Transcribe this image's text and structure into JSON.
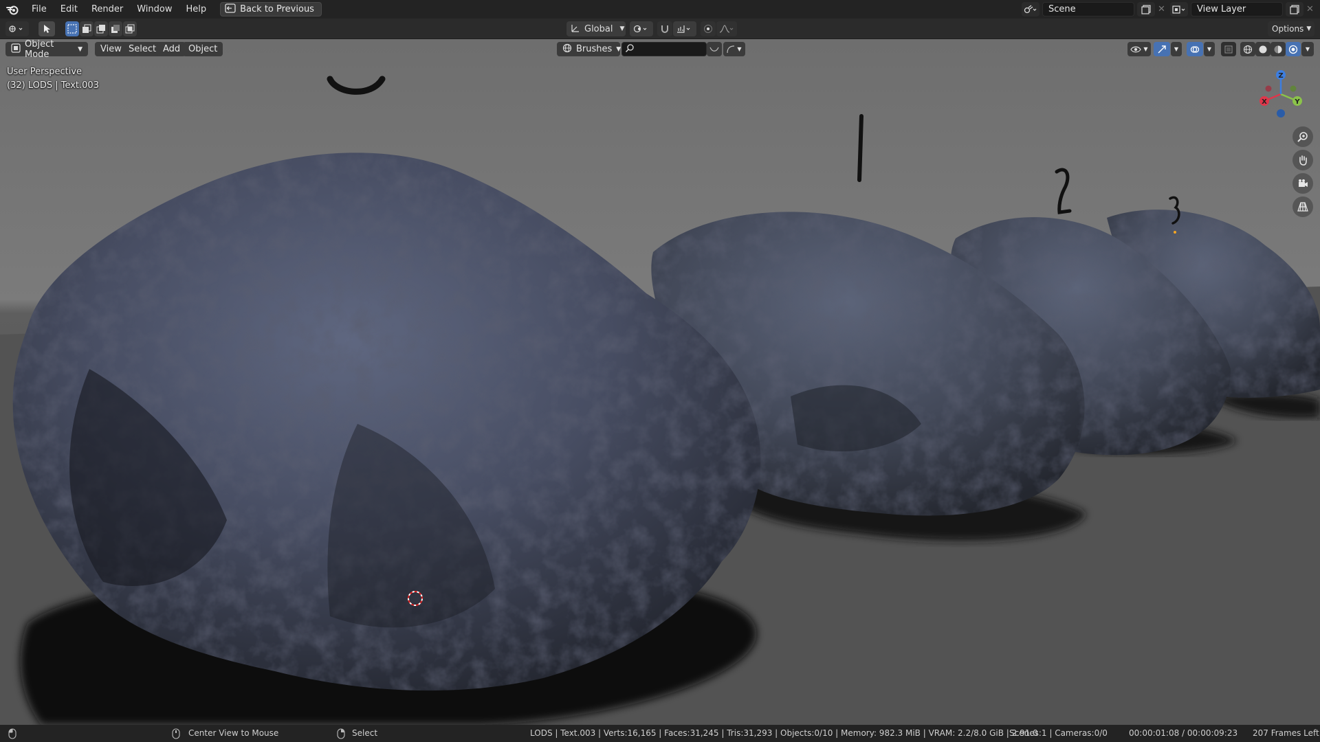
{
  "menu": {
    "file": "File",
    "edit": "Edit",
    "render": "Render",
    "window": "Window",
    "help": "Help",
    "back_to_previous": "Back to Previous"
  },
  "scene": {
    "name": "Scene",
    "view_layer": "View Layer"
  },
  "tool_header": {
    "orientation": "Global",
    "options": "Options"
  },
  "viewport_header": {
    "mode": "Object Mode",
    "view": "View",
    "select": "Select",
    "add": "Add",
    "object": "Object",
    "brushes": "Brushes"
  },
  "overlay": {
    "perspective": "User Perspective",
    "collection_info": "(32) LODS | Text.003"
  },
  "gizmo": {
    "x": "X",
    "y": "Y",
    "z": "Z"
  },
  "scene_labels": {
    "l1": "1",
    "l2": "2",
    "l3": "3"
  },
  "status": {
    "center_view": "Center View to Mouse",
    "select": "Select",
    "stats": "LODS | Text.003 | Verts:16,165 | Faces:31,245 | Tris:31,293 | Objects:0/10 | Memory: 982.3 MiB | VRAM: 2.2/8.0 GiB | 2.91.0",
    "scenes": "Scenes:1 | Cameras:0/0",
    "time": "00:00:01:08 / 00:00:09:23",
    "frames_left": "207 Frames Left"
  },
  "colors": {
    "accent": "#4772b3",
    "axis_x": "#e0364a",
    "axis_y": "#8bc34a",
    "axis_z": "#3d7ee0",
    "rock": "#3e4458"
  }
}
